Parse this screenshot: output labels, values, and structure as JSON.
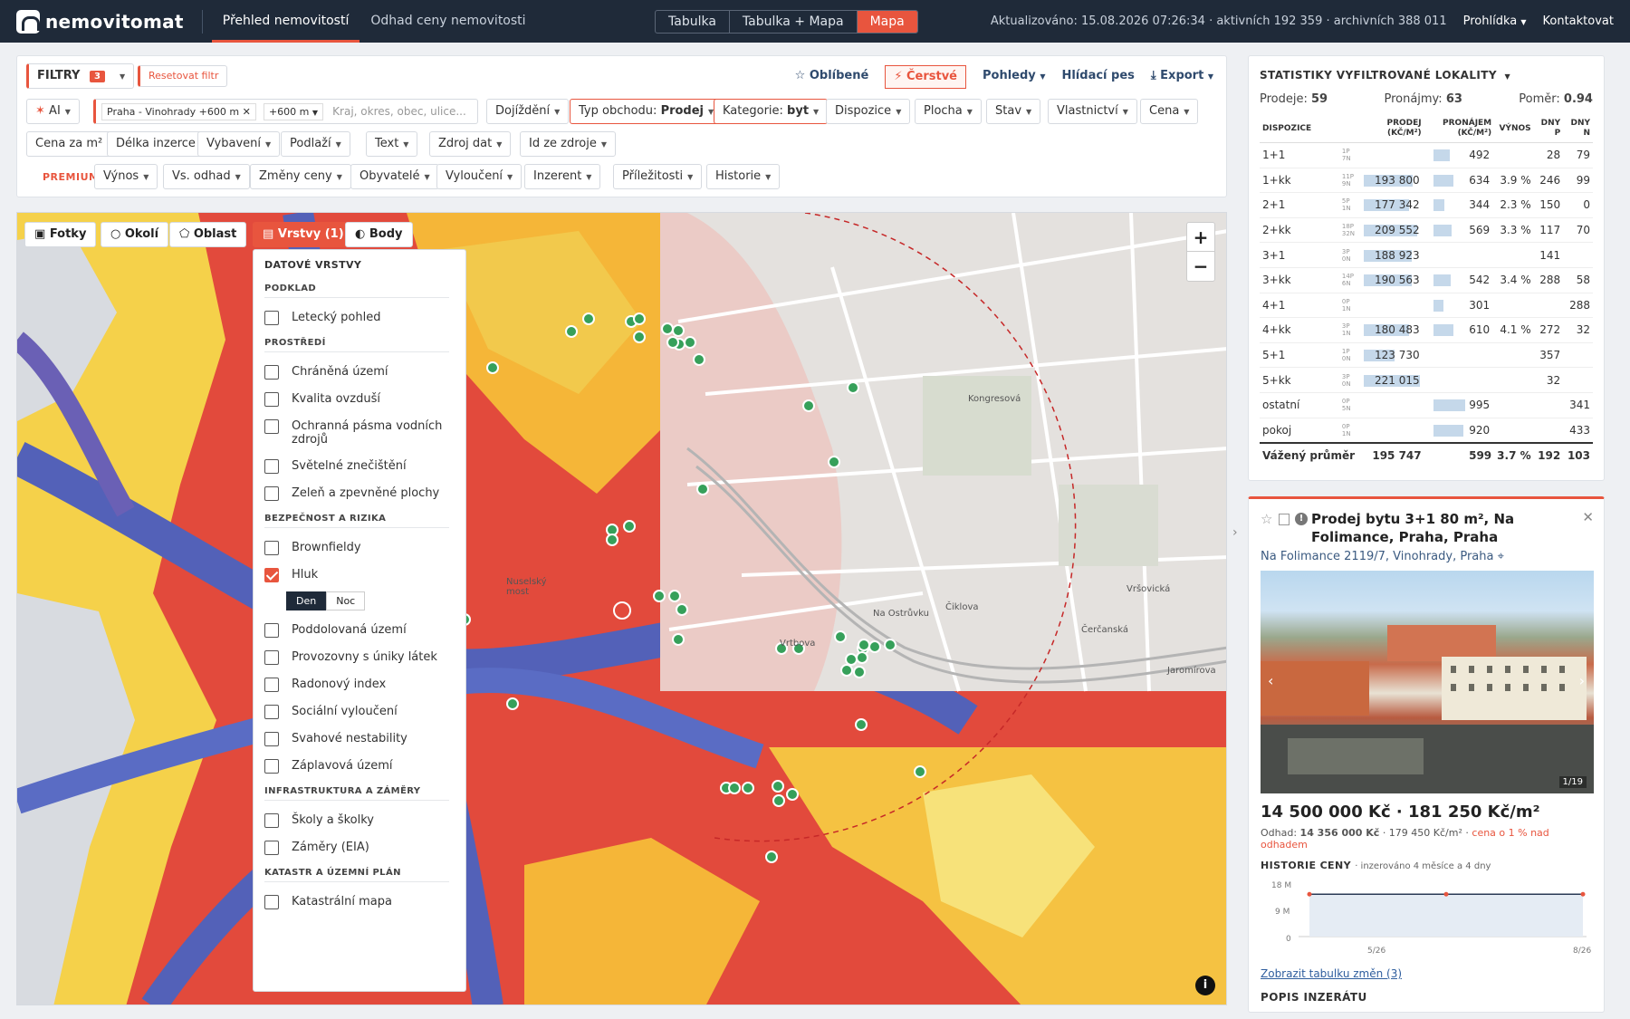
{
  "brand": "nemovitomat",
  "nav": {
    "tabs": [
      "Přehled nemovitostí",
      "Odhad ceny nemovitosti"
    ]
  },
  "views": [
    "Tabulka",
    "Tabulka + Mapa",
    "Mapa"
  ],
  "status": "Aktualizováno: 15.08.2026 07:26:34 · aktivních 192 359 · archivních 388 011",
  "top_right": [
    "Prohlídka",
    "Kontaktovat"
  ],
  "filters": {
    "label": "FILTRY",
    "count": "3",
    "reset": "Resetovat filtr",
    "fav": "Oblíbené",
    "fresh": "Čerstvé",
    "views": "Pohledy",
    "watch": "Hlídací pes",
    "export": "Export",
    "ai": "AI",
    "location": "Praha - Vinohrady +600 m",
    "radius": "+600 m",
    "search_placeholder": "Kraj, okres, obec, ulice...",
    "commute": "Dojíždění",
    "deal_label": "Typ obchodu:",
    "deal_value": "Prodej",
    "cat_label": "Kategorie:",
    "cat_value": "byt",
    "disposition": "Dispozice",
    "area": "Plocha",
    "state": "Stav",
    "ownership": "Vlastnictví",
    "price": "Cena",
    "row2": [
      "Cena za m²",
      "Délka inzerce",
      "Vybavení",
      "Podlaží",
      "Text",
      "Zdroj dat",
      "Id ze zdroje"
    ],
    "premium": "PREMIUM",
    "row3": [
      "Výnos",
      "Vs. odhad",
      "Změny ceny",
      "Obyvatelé",
      "Vyloučení",
      "Inzerent",
      "Příležitosti",
      "Historie"
    ]
  },
  "map_buttons": [
    "Fotky",
    "Okolí",
    "Oblast",
    "Vrstvy (1)",
    "Body"
  ],
  "labels_on_map": [
    "Nuselský most",
    "Na Ostrůvku",
    "Vrtbova",
    "Čiklova",
    "Kongresová",
    "Vršovická",
    "Jaromírova",
    "Čerčanská"
  ],
  "layers": {
    "title": "DATOVÉ VRSTVY",
    "sections": [
      {
        "title": "PODKLAD",
        "items": [
          {
            "label": "Letecký pohled",
            "checked": false
          }
        ]
      },
      {
        "title": "PROSTŘEDÍ",
        "items": [
          {
            "label": "Chráněná území",
            "checked": false
          },
          {
            "label": "Kvalita ovzduší",
            "checked": false
          },
          {
            "label": "Ochranná pásma vodních zdrojů",
            "checked": false
          },
          {
            "label": "Světelné znečištění",
            "checked": false
          },
          {
            "label": "Zeleň a zpevněné plochy",
            "checked": false
          }
        ]
      },
      {
        "title": "BEZPEČNOST A RIZIKA",
        "items": [
          {
            "label": "Brownfieldy",
            "checked": false
          },
          {
            "label": "Hluk",
            "checked": true
          },
          {
            "label": "Poddolovaná území",
            "checked": false
          },
          {
            "label": "Provozovny s úniky látek",
            "checked": false
          },
          {
            "label": "Radonový index",
            "checked": false
          },
          {
            "label": "Sociální vyloučení",
            "checked": false
          },
          {
            "label": "Svahové nestability",
            "checked": false
          },
          {
            "label": "Záplavová území",
            "checked": false
          }
        ]
      },
      {
        "title": "INFRASTRUKTURA A ZÁMĚRY",
        "items": [
          {
            "label": "Školy a školky",
            "checked": false
          },
          {
            "label": "Záměry (EIA)",
            "checked": false
          }
        ]
      },
      {
        "title": "KATASTR A ÚZEMNÍ PLÁN",
        "items": [
          {
            "label": "Katastrální mapa",
            "checked": false
          }
        ]
      }
    ],
    "day_night": [
      "Den",
      "Noc"
    ]
  },
  "stats": {
    "title": "STATISTIKY VYFILTROVANÉ LOKALITY",
    "sales_label": "Prodeje:",
    "sales": "59",
    "rent_label": "Pronájmy:",
    "rent": "63",
    "ratio_label": "Poměr:",
    "ratio": "0.94",
    "headers": [
      "DISPOZICE",
      "PRODEJ (KČ/M²)",
      "PRONÁJEM (KČ/M²)",
      "VÝNOS",
      "DNY P",
      "DNY N"
    ],
    "rows": [
      {
        "d": "1+1",
        "pn": [
          "1P",
          "7N"
        ],
        "sale": "",
        "sf": 0,
        "rent": "492",
        "rf": 0.5,
        "yield": "",
        "dp": "28",
        "dn": "79"
      },
      {
        "d": "1+kk",
        "pn": [
          "11P",
          "9N"
        ],
        "sale": "193 800",
        "sf": 0.85,
        "rent": "634",
        "rf": 0.63,
        "yield": "3.9 %",
        "dp": "246",
        "dn": "99"
      },
      {
        "d": "2+1",
        "pn": [
          "5P",
          "1N"
        ],
        "sale": "177 342",
        "sf": 0.78,
        "rent": "344",
        "rf": 0.35,
        "yield": "2.3 %",
        "dp": "150",
        "dn": "0"
      },
      {
        "d": "2+kk",
        "pn": [
          "18P",
          "32N"
        ],
        "sale": "209 552",
        "sf": 0.92,
        "rent": "569",
        "rf": 0.57,
        "yield": "3.3 %",
        "dp": "117",
        "dn": "70"
      },
      {
        "d": "3+1",
        "pn": [
          "3P",
          "0N"
        ],
        "sale": "188 923",
        "sf": 0.83,
        "rent": "",
        "rf": 0,
        "yield": "",
        "dp": "141",
        "dn": ""
      },
      {
        "d": "3+kk",
        "pn": [
          "14P",
          "6N"
        ],
        "sale": "190 563",
        "sf": 0.84,
        "rent": "542",
        "rf": 0.54,
        "yield": "3.4 %",
        "dp": "288",
        "dn": "58"
      },
      {
        "d": "4+1",
        "pn": [
          "0P",
          "1N"
        ],
        "sale": "",
        "sf": 0,
        "rent": "301",
        "rf": 0.3,
        "yield": "",
        "dp": "",
        "dn": "288"
      },
      {
        "d": "4+kk",
        "pn": [
          "3P",
          "1N"
        ],
        "sale": "180 483",
        "sf": 0.79,
        "rent": "610",
        "rf": 0.61,
        "yield": "4.1 %",
        "dp": "272",
        "dn": "32"
      },
      {
        "d": "5+1",
        "pn": [
          "1P",
          "0N"
        ],
        "sale": "123 730",
        "sf": 0.54,
        "rent": "",
        "rf": 0,
        "yield": "",
        "dp": "357",
        "dn": ""
      },
      {
        "d": "5+kk",
        "pn": [
          "3P",
          "0N"
        ],
        "sale": "221 015",
        "sf": 0.97,
        "rent": "",
        "rf": 0,
        "yield": "",
        "dp": "32",
        "dn": ""
      },
      {
        "d": "ostatní",
        "pn": [
          "0P",
          "5N"
        ],
        "sale": "",
        "sf": 0,
        "rent": "995",
        "rf": 0.99,
        "yield": "",
        "dp": "",
        "dn": "341"
      },
      {
        "d": "pokoj",
        "pn": [
          "0P",
          "1N"
        ],
        "sale": "",
        "sf": 0,
        "rent": "920",
        "rf": 0.92,
        "yield": "",
        "dp": "",
        "dn": "433"
      }
    ],
    "total": {
      "d": "Vážený průměr",
      "sale": "195 747",
      "rent": "599",
      "yield": "3.7 %",
      "dp": "192",
      "dn": "103"
    }
  },
  "detail": {
    "title": "Prodej bytu 3+1 80 m², Na Folimance, Praha, Praha",
    "address": "Na Folimance 2119/7, Vinohrady, Praha",
    "photo_counter": "1/19",
    "price": "14 500 000 Kč · 181 250 Kč/m²",
    "odhad_label": "Odhad:",
    "odhad_value": "14 356 000 Kč",
    "odhad_m2": "· 179 450 Kč/m² ·",
    "odhad_note": "cena o 1 % nad odhadem",
    "history_title": "HISTORIE CENY",
    "history_note": "· inzerováno 4 měsíce a 4 dny",
    "history_y": [
      "18 M",
      "9 M",
      "0"
    ],
    "history_x": [
      "5/26",
      "8/26"
    ],
    "history_values": [
      14.5,
      14.5,
      14.5
    ],
    "link": "Zobrazit tabulku změn (3)",
    "popis": "POPIS INZERÁTU"
  }
}
